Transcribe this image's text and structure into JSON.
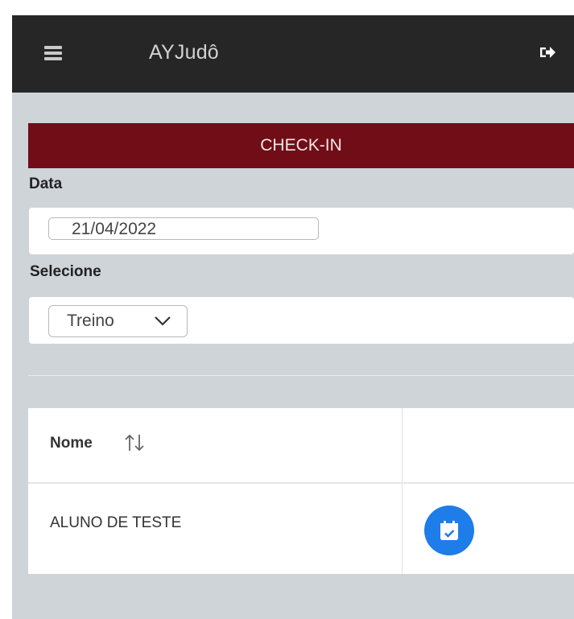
{
  "header": {
    "title": "AYJudô",
    "menu_icon": "hamburger-menu-icon",
    "logout_icon": "sign-out-icon"
  },
  "banner": {
    "label": "CHECK-IN"
  },
  "form": {
    "date_label": "Data",
    "date_value": "21/04/2022",
    "select_label": "Selecione",
    "select_value": "Treino",
    "select_icon": "chevron-down-icon"
  },
  "table": {
    "columns": [
      "Nome",
      ""
    ],
    "sort_icon": "sort-arrows-icon",
    "rows": [
      {
        "nome": "ALUNO DE TESTE",
        "action_icon": "calendar-check-icon"
      }
    ]
  },
  "colors": {
    "topbar": "#262626",
    "banner": "#710d17",
    "background": "#cfd4d9",
    "action_button": "#1e7de8"
  }
}
